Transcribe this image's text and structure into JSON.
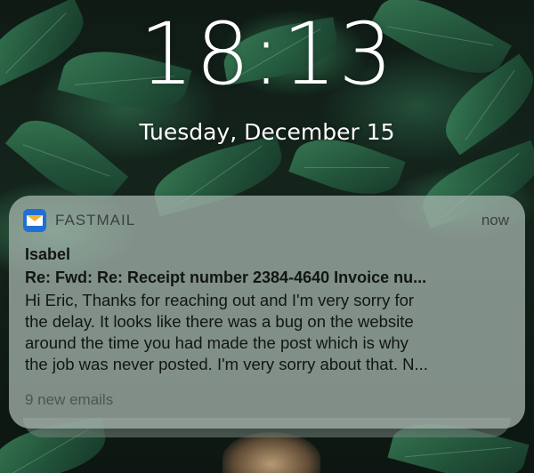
{
  "lockscreen": {
    "time": "18:13",
    "date": "Tuesday, December 15"
  },
  "notification": {
    "app_icon": "fastmail-envelope-icon",
    "app_name": "FASTMAIL",
    "timestamp": "now",
    "sender": "Isabel",
    "subject": "Re: Fwd: Re: Receipt number 2384-4640 Invoice nu...",
    "body_lines": [
      "Hi Eric, Thanks for reaching out and I'm very sorry for",
      "the delay. It looks like there was a bug on the website",
      "around the time you had made the post which is why",
      "the job was never posted. I'm very sorry about that. N..."
    ],
    "footer": "9 new emails"
  }
}
